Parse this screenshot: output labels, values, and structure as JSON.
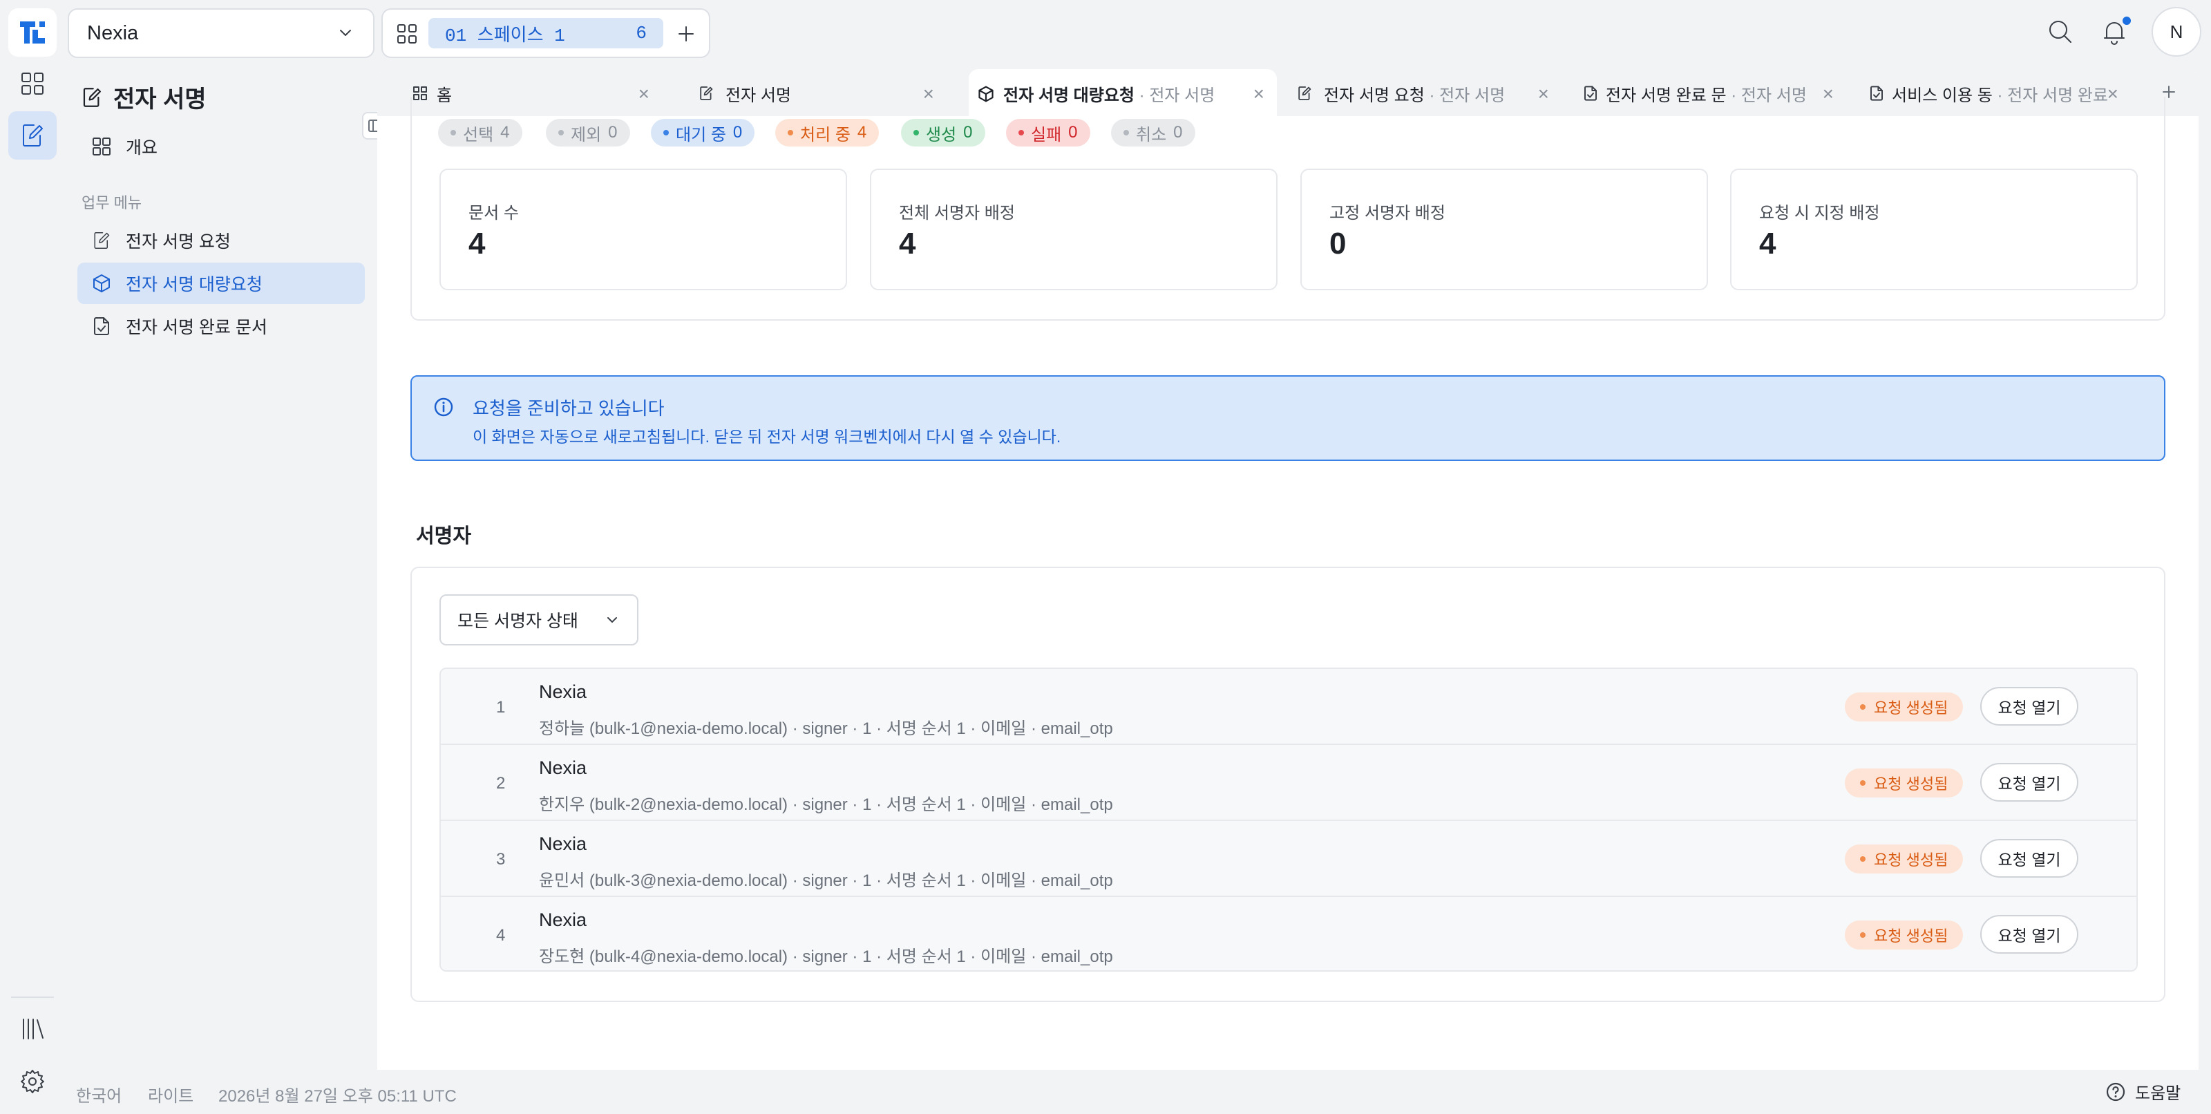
{
  "workspace": {
    "name": "Nexia"
  },
  "space": {
    "label": "01 스페이스 1",
    "count": "6"
  },
  "user": {
    "initial": "N"
  },
  "sidebar": {
    "title": "전자 서명",
    "overview": "개요",
    "section": "업무 메뉴",
    "items": [
      {
        "label": "전자 서명 요청"
      },
      {
        "label": "전자 서명 대량요청"
      },
      {
        "label": "전자 서명 완료 문서"
      }
    ]
  },
  "tabs": [
    {
      "label": "홈",
      "sub": ""
    },
    {
      "label": "전자 서명",
      "sub": ""
    },
    {
      "label": "전자 서명 대량요청",
      "sub": "· 전자 서명"
    },
    {
      "label": "전자 서명 요청",
      "sub": "· 전자 서명"
    },
    {
      "label": "전자 서명 완료 문",
      "sub": "· 전자 서명"
    },
    {
      "label": "서비스 이용 동",
      "sub": "· 전자 서명 완료"
    }
  ],
  "status_chips": [
    {
      "label": "선택",
      "count": "4",
      "color": "#8a9099",
      "bg": "#e9eaec"
    },
    {
      "label": "제외",
      "count": "0",
      "color": "#8a9099",
      "bg": "#e9eaec"
    },
    {
      "label": "대기 중",
      "count": "0",
      "color": "#1b5fcf",
      "bg": "#d9e6f8"
    },
    {
      "label": "처리 중",
      "count": "4",
      "color": "#d95b13",
      "bg": "#fde4d6"
    },
    {
      "label": "생성",
      "count": "0",
      "color": "#1f8a4c",
      "bg": "#d8f0e0"
    },
    {
      "label": "실패",
      "count": "0",
      "color": "#d0262b",
      "bg": "#fbd9d9"
    },
    {
      "label": "취소",
      "count": "0",
      "color": "#8a9099",
      "bg": "#e9eaec"
    }
  ],
  "summary": [
    {
      "label": "문서 수",
      "value": "4"
    },
    {
      "label": "전체 서명자 배정",
      "value": "4"
    },
    {
      "label": "고정 서명자 배정",
      "value": "0"
    },
    {
      "label": "요청 시 지정 배정",
      "value": "4"
    }
  ],
  "alert": {
    "title": "요청을 준비하고 있습니다",
    "body": "이 화면은 자동으로 새로고침됩니다. 닫은 뒤 전자 서명 워크벤치에서 다시 열 수 있습니다."
  },
  "signers": {
    "title": "서명자",
    "filter": "모든 서명자 상태",
    "rows": [
      {
        "index": "1",
        "name": "Nexia",
        "detail": "정하늘 (bulk-1@nexia-demo.local) · signer · 1 · 서명 순서 1 · 이메일 · email_otp",
        "status": "요청 생성됨",
        "action": "요청 열기"
      },
      {
        "index": "2",
        "name": "Nexia",
        "detail": "한지우 (bulk-2@nexia-demo.local) · signer · 1 · 서명 순서 1 · 이메일 · email_otp",
        "status": "요청 생성됨",
        "action": "요청 열기"
      },
      {
        "index": "3",
        "name": "Nexia",
        "detail": "윤민서 (bulk-3@nexia-demo.local) · signer · 1 · 서명 순서 1 · 이메일 · email_otp",
        "status": "요청 생성됨",
        "action": "요청 열기"
      },
      {
        "index": "4",
        "name": "Nexia",
        "detail": "장도현 (bulk-4@nexia-demo.local) · signer · 1 · 서명 순서 1 · 이메일 · email_otp",
        "status": "요청 생성됨",
        "action": "요청 열기"
      }
    ]
  },
  "footer": {
    "language": "한국어",
    "theme": "라이트",
    "datetime": "2026년 8월 27일 오후 05:11 UTC",
    "help": "도움말"
  }
}
